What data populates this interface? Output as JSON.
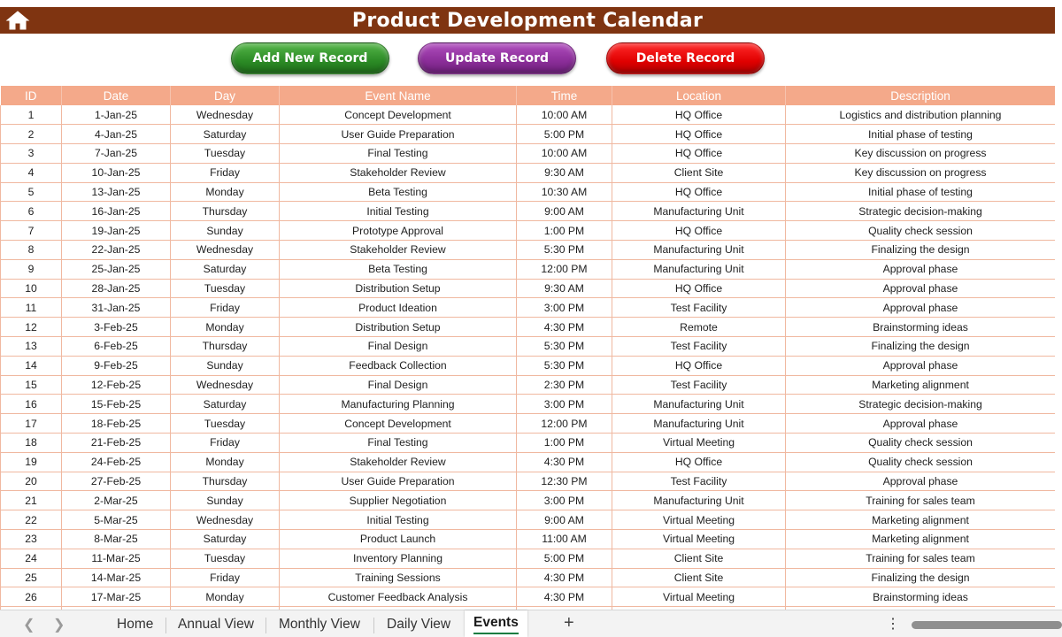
{
  "header": {
    "title": "Product Development Calendar",
    "title_bg": "#7f3411",
    "home_icon": "home-icon"
  },
  "actions": {
    "add_label": "Add New Record",
    "update_label": "Update Record",
    "delete_label": "Delete Record",
    "add_color": "#2b8a25",
    "update_color": "#8a2d98",
    "delete_color": "#e00000"
  },
  "table": {
    "header_bg": "#f4a98a",
    "columns": [
      "ID",
      "Date",
      "Day",
      "Event Name",
      "Time",
      "Location",
      "Description"
    ],
    "rows": [
      [
        "1",
        "1-Jan-25",
        "Wednesday",
        "Concept Development",
        "10:00 AM",
        "HQ Office",
        "Logistics and distribution planning"
      ],
      [
        "2",
        "4-Jan-25",
        "Saturday",
        "User Guide Preparation",
        "5:00 PM",
        "HQ Office",
        "Initial phase of testing"
      ],
      [
        "3",
        "7-Jan-25",
        "Tuesday",
        "Final Testing",
        "10:00 AM",
        "HQ Office",
        "Key discussion on progress"
      ],
      [
        "4",
        "10-Jan-25",
        "Friday",
        "Stakeholder Review",
        "9:30 AM",
        "Client Site",
        "Key discussion on progress"
      ],
      [
        "5",
        "13-Jan-25",
        "Monday",
        "Beta Testing",
        "10:30 AM",
        "HQ Office",
        "Initial phase of testing"
      ],
      [
        "6",
        "16-Jan-25",
        "Thursday",
        "Initial Testing",
        "9:00 AM",
        "Manufacturing Unit",
        "Strategic decision-making"
      ],
      [
        "7",
        "19-Jan-25",
        "Sunday",
        "Prototype Approval",
        "1:00 PM",
        "HQ Office",
        "Quality check session"
      ],
      [
        "8",
        "22-Jan-25",
        "Wednesday",
        "Stakeholder Review",
        "5:30 PM",
        "Manufacturing Unit",
        "Finalizing the design"
      ],
      [
        "9",
        "25-Jan-25",
        "Saturday",
        "Beta Testing",
        "12:00 PM",
        "Manufacturing Unit",
        "Approval phase"
      ],
      [
        "10",
        "28-Jan-25",
        "Tuesday",
        "Distribution Setup",
        "9:30 AM",
        "HQ Office",
        "Approval phase"
      ],
      [
        "11",
        "31-Jan-25",
        "Friday",
        "Product Ideation",
        "3:00 PM",
        "Test Facility",
        "Approval phase"
      ],
      [
        "12",
        "3-Feb-25",
        "Monday",
        "Distribution Setup",
        "4:30 PM",
        "Remote",
        "Brainstorming ideas"
      ],
      [
        "13",
        "6-Feb-25",
        "Thursday",
        "Final Design",
        "5:30 PM",
        "Test Facility",
        "Finalizing the design"
      ],
      [
        "14",
        "9-Feb-25",
        "Sunday",
        "Feedback Collection",
        "5:30 PM",
        "HQ Office",
        "Approval phase"
      ],
      [
        "15",
        "12-Feb-25",
        "Wednesday",
        "Final Design",
        "2:30 PM",
        "Test Facility",
        "Marketing alignment"
      ],
      [
        "16",
        "15-Feb-25",
        "Saturday",
        "Manufacturing Planning",
        "3:00 PM",
        "Manufacturing Unit",
        "Strategic decision-making"
      ],
      [
        "17",
        "18-Feb-25",
        "Tuesday",
        "Concept Development",
        "12:00 PM",
        "Manufacturing Unit",
        "Approval phase"
      ],
      [
        "18",
        "21-Feb-25",
        "Friday",
        "Final Testing",
        "1:00 PM",
        "Virtual Meeting",
        "Quality check session"
      ],
      [
        "19",
        "24-Feb-25",
        "Monday",
        "Stakeholder Review",
        "4:30 PM",
        "HQ Office",
        "Quality check session"
      ],
      [
        "20",
        "27-Feb-25",
        "Thursday",
        "User Guide Preparation",
        "12:30 PM",
        "Test Facility",
        "Approval phase"
      ],
      [
        "21",
        "2-Mar-25",
        "Sunday",
        "Supplier Negotiation",
        "3:00 PM",
        "Manufacturing Unit",
        "Training for sales team"
      ],
      [
        "22",
        "5-Mar-25",
        "Wednesday",
        "Initial Testing",
        "9:00 AM",
        "Virtual Meeting",
        "Marketing alignment"
      ],
      [
        "23",
        "8-Mar-25",
        "Saturday",
        "Product Launch",
        "11:00 AM",
        "Virtual Meeting",
        "Marketing alignment"
      ],
      [
        "24",
        "11-Mar-25",
        "Tuesday",
        "Inventory Planning",
        "5:00 PM",
        "Client Site",
        "Training for sales team"
      ],
      [
        "25",
        "14-Mar-25",
        "Friday",
        "Training Sessions",
        "4:30 PM",
        "Client Site",
        "Finalizing the design"
      ],
      [
        "26",
        "17-Mar-25",
        "Monday",
        "Customer Feedback Analysis",
        "4:30 PM",
        "Virtual Meeting",
        "Brainstorming ideas"
      ],
      [
        "",
        "",
        "",
        "",
        "",
        "",
        ""
      ]
    ]
  },
  "sheet_tabs": {
    "tabs": [
      "Home",
      "Annual View",
      "Monthly View",
      "Daily View",
      "Events"
    ],
    "active": "Events",
    "add_icon": "plus-icon",
    "more_icon": "more-options-icon",
    "prev_icon": "chevron-left-icon",
    "next_icon": "chevron-right-icon"
  }
}
